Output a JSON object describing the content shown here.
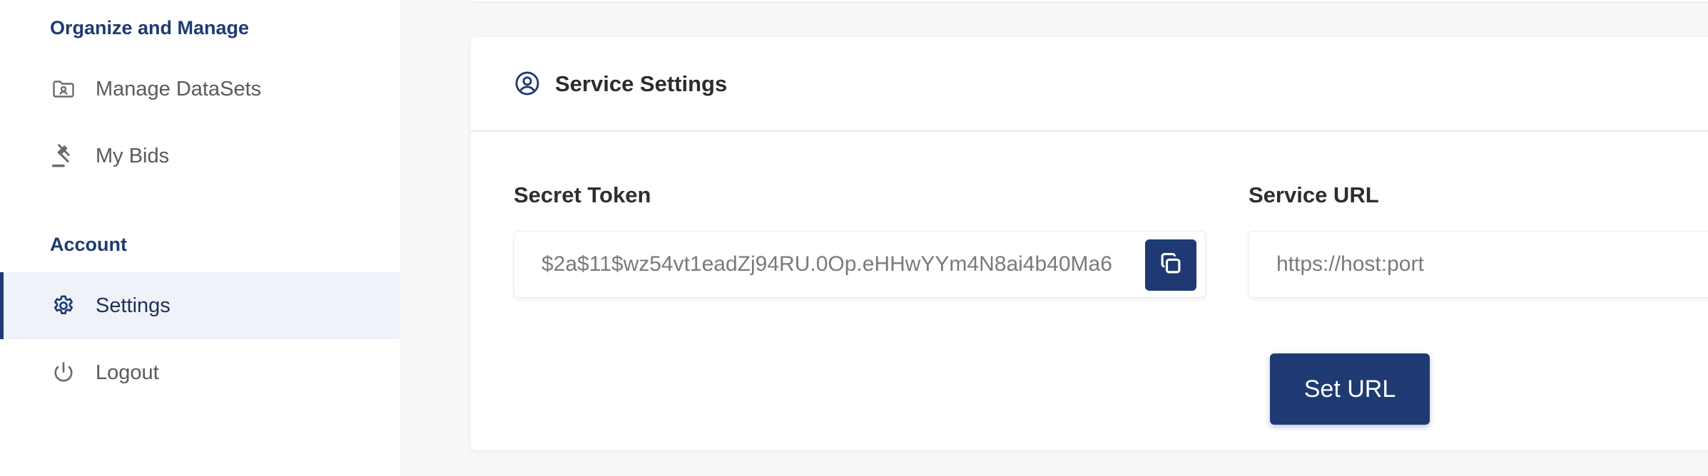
{
  "sidebar": {
    "sections": [
      {
        "title": "Organize and Manage",
        "items": [
          {
            "label": "Manage DataSets",
            "icon": "folder-user-icon"
          },
          {
            "label": "My Bids",
            "icon": "gavel-icon"
          }
        ]
      },
      {
        "title": "Account",
        "items": [
          {
            "label": "Settings",
            "icon": "gear-icon",
            "active": true
          },
          {
            "label": "Logout",
            "icon": "power-icon"
          }
        ]
      }
    ]
  },
  "service_settings": {
    "title": "Service Settings",
    "icon": "user-circle-icon",
    "secret_token": {
      "label": "Secret Token",
      "value": "$2a$11$wz54vt1eadZj94RU.0Op.eHHwYYm4N8ai4b40Ma6"
    },
    "service_url": {
      "label": "Service URL",
      "placeholder": "https://host:port"
    },
    "set_url_button": "Set URL"
  },
  "colors": {
    "accent": "#1f3a73",
    "active_bg": "#eff2f8",
    "page_bg": "#f8f8f8"
  }
}
